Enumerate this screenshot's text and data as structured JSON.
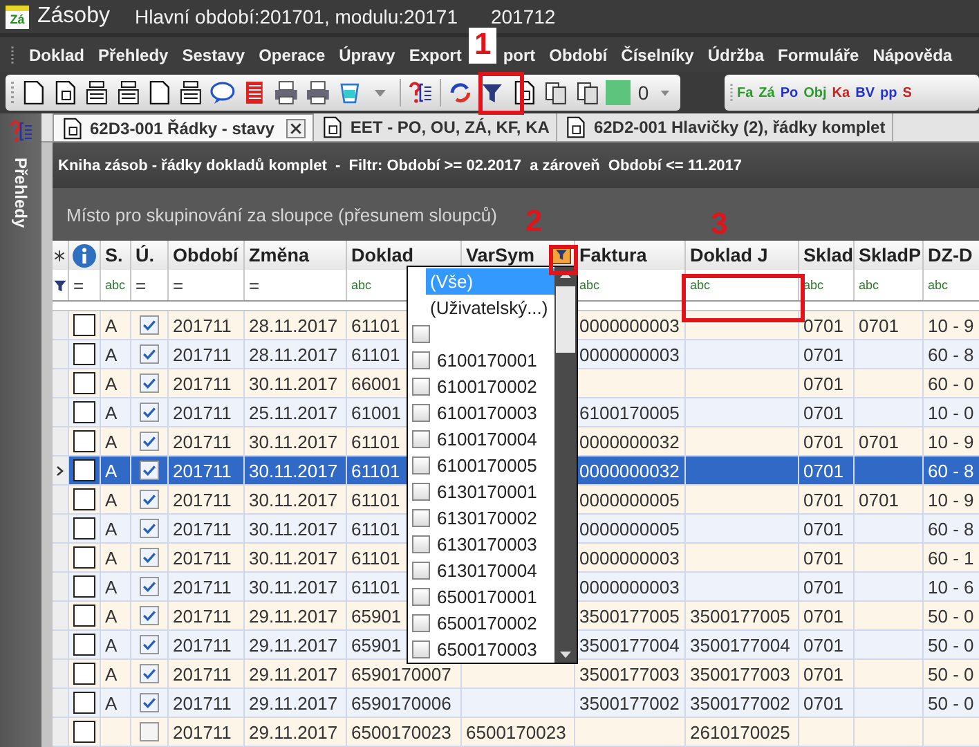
{
  "window": {
    "logo": "Zá",
    "title": "Zásoby",
    "subtitle_parts": [
      "Hlavní období:201701, modulu:20171",
      "201712"
    ]
  },
  "menu": [
    {
      "label": "Doklad"
    },
    {
      "label": "Přehledy"
    },
    {
      "label": "Sestavy"
    },
    {
      "label": "Operace"
    },
    {
      "label": "Úpravy"
    },
    {
      "label": "Export"
    },
    {
      "label": "port"
    },
    {
      "label": "Období"
    },
    {
      "label": "Číselníky"
    },
    {
      "label": "Údržba"
    },
    {
      "label": "Formuláře"
    },
    {
      "label": "Nápověda"
    }
  ],
  "toolbar": {
    "counter": "0",
    "quick_buttons": [
      {
        "label": "Fa",
        "color": "#2a9a2a"
      },
      {
        "label": "Zá",
        "color": "#2a9a2a"
      },
      {
        "label": "Po",
        "color": "#2233cc"
      },
      {
        "label": "Obj",
        "color": "#2a9a2a"
      },
      {
        "label": "Ka",
        "color": "#cc2222"
      },
      {
        "label": "BV",
        "color": "#2233cc"
      },
      {
        "label": "pp",
        "color": "#2233cc"
      },
      {
        "label": "S",
        "color": "#cc2222"
      }
    ]
  },
  "sidebar": {
    "label": "Přehledy"
  },
  "tabs": [
    {
      "label": "62D3-001 Řádky - stavy",
      "selected": true
    },
    {
      "label": "EET - PO, OU, ZÁ, KF, KA",
      "selected": false
    },
    {
      "label": "62D2-001 Hlavičky (2), řádky komplet",
      "selected": false
    }
  ],
  "grid": {
    "caption": "Kniha zásob - řádky dokladů komplet  -  Filtr: Období >= 02.2017  a zároveň  Období <= 11.2017",
    "group_hint": "Místo pro skupinování za sloupce (přesunem sloupců)",
    "columns": [
      {
        "kind": "indicator"
      },
      {
        "kind": "select",
        "filter": "="
      },
      {
        "kind": "text",
        "title": "S.",
        "filter": "abc"
      },
      {
        "kind": "check",
        "title": "Ú.",
        "filter": "="
      },
      {
        "kind": "text",
        "title": "Období",
        "filter": "="
      },
      {
        "kind": "text",
        "title": "Změna",
        "filter": "="
      },
      {
        "kind": "text",
        "title": "Doklad",
        "filter": "abc"
      },
      {
        "kind": "text",
        "title": "VarSym",
        "filtered": true
      },
      {
        "kind": "text",
        "title": "Faktura",
        "filter": "abc"
      },
      {
        "kind": "text",
        "title": "Doklad J",
        "filter": "abc"
      },
      {
        "kind": "text",
        "title": "Sklad",
        "filter": "abc"
      },
      {
        "kind": "text",
        "title": "SkladP",
        "filter": "abc"
      },
      {
        "kind": "text",
        "title": "DZ-D",
        "filter": "abc"
      }
    ],
    "rows": [
      {
        "selected": false,
        "marked": false,
        "s": "A",
        "checked": true,
        "obdobi": "201711",
        "zmena": "28.11.2017",
        "doklad": "61101",
        "faktura": "0000000003",
        "sklad": "0701",
        "sklad_p": "0701",
        "dz_d": "10 - 9"
      },
      {
        "selected": false,
        "marked": false,
        "s": "A",
        "checked": true,
        "obdobi": "201711",
        "zmena": "28.11.2017",
        "doklad": "61101",
        "faktura": "0000000003",
        "sklad": "0701",
        "dz_d": "60 - 8"
      },
      {
        "selected": false,
        "marked": false,
        "s": "A",
        "checked": true,
        "obdobi": "201711",
        "zmena": "30.11.2017",
        "doklad": "66001",
        "sklad": "0701",
        "dz_d": "60 - 0"
      },
      {
        "selected": false,
        "marked": false,
        "s": "A",
        "checked": true,
        "obdobi": "201711",
        "zmena": "25.11.2017",
        "doklad": "61001",
        "faktura": "6100170005",
        "sklad": "0701",
        "dz_d": "10 - 0"
      },
      {
        "selected": false,
        "marked": false,
        "s": "A",
        "checked": true,
        "obdobi": "201711",
        "zmena": "30.11.2017",
        "doklad": "61101",
        "faktura": "0000000032",
        "sklad": "0701",
        "sklad_p": "0701",
        "dz_d": "10 - 9"
      },
      {
        "selected": true,
        "marked": false,
        "s": "A",
        "checked": true,
        "obdobi": "201711",
        "zmena": "30.11.2017",
        "doklad": "61101",
        "faktura": "0000000032",
        "sklad": "0701",
        "dz_d": "60 - 8"
      },
      {
        "selected": false,
        "marked": false,
        "s": "A",
        "checked": true,
        "obdobi": "201711",
        "zmena": "30.11.2017",
        "doklad": "61101",
        "faktura": "0000000005",
        "sklad": "0701",
        "sklad_p": "0701",
        "dz_d": "10 - 9"
      },
      {
        "selected": false,
        "marked": false,
        "s": "A",
        "checked": true,
        "obdobi": "201711",
        "zmena": "30.11.2017",
        "doklad": "61101",
        "faktura": "0000000005",
        "sklad": "0701",
        "dz_d": "60 - 8"
      },
      {
        "selected": false,
        "marked": false,
        "s": "A",
        "checked": true,
        "obdobi": "201711",
        "zmena": "30.11.2017",
        "doklad": "61101",
        "faktura": "0000000003",
        "sklad": "0701",
        "dz_d": "60 - 1"
      },
      {
        "selected": false,
        "marked": false,
        "s": "A",
        "checked": true,
        "obdobi": "201711",
        "zmena": "30.11.2017",
        "doklad": "61101",
        "faktura": "0000000003",
        "sklad": "0701",
        "dz_d": "10 - 6"
      },
      {
        "selected": false,
        "marked": false,
        "s": "A",
        "checked": true,
        "obdobi": "201711",
        "zmena": "29.11.2017",
        "doklad": "65901",
        "faktura": "3500177005",
        "doklad_j": "3500177005",
        "sklad": "0701",
        "dz_d": "50 - 0"
      },
      {
        "selected": false,
        "marked": false,
        "s": "A",
        "checked": true,
        "obdobi": "201711",
        "zmena": "29.11.2017",
        "doklad": "65901",
        "faktura": "3500177004",
        "doklad_j": "3500177004",
        "sklad": "0701",
        "dz_d": "50 - 0"
      },
      {
        "selected": false,
        "marked": false,
        "s": "A",
        "checked": true,
        "obdobi": "201711",
        "zmena": "29.11.2017",
        "doklad": "6590170007",
        "faktura": "3500177003",
        "doklad_j": "3500177003",
        "sklad": "0701",
        "dz_d": "50 - 0"
      },
      {
        "selected": false,
        "marked": false,
        "s": "A",
        "checked": true,
        "obdobi": "201711",
        "zmena": "29.11.2017",
        "doklad": "6590170006",
        "faktura": "3500177002",
        "doklad_j": "3500177002",
        "sklad": "0701",
        "dz_d": "50 - 0"
      },
      {
        "selected": false,
        "marked": false,
        "checked": false,
        "obdobi": "201711",
        "zmena": "29.11.2017",
        "doklad": "6500170023",
        "var_sym": "6500170023",
        "doklad_j": "2610170025"
      }
    ]
  },
  "filter_popup": {
    "items": [
      {
        "kind": "option",
        "label": "(Vše)",
        "selected": true
      },
      {
        "kind": "option",
        "label": "(Uživatelský...)",
        "selected": false
      },
      {
        "kind": "check",
        "checked": false
      },
      {
        "kind": "check",
        "label": "6100170001",
        "checked": false
      },
      {
        "kind": "check",
        "label": "6100170002",
        "checked": false
      },
      {
        "kind": "check",
        "label": "6100170003",
        "checked": false
      },
      {
        "kind": "check",
        "label": "6100170004",
        "checked": false
      },
      {
        "kind": "check",
        "label": "6100170005",
        "checked": false
      },
      {
        "kind": "check",
        "label": "6130170001",
        "checked": false
      },
      {
        "kind": "check",
        "label": "6130170002",
        "checked": false
      },
      {
        "kind": "check",
        "label": "6130170003",
        "checked": false
      },
      {
        "kind": "check",
        "label": "6130170004",
        "checked": false
      },
      {
        "kind": "check",
        "label": "6500170001",
        "checked": false
      },
      {
        "kind": "check",
        "label": "6500170002",
        "checked": false
      },
      {
        "kind": "check",
        "label": "6500170003",
        "checked": false
      }
    ]
  },
  "annotations": [
    {
      "label": "1"
    },
    {
      "label": "2"
    },
    {
      "label": "3"
    }
  ]
}
